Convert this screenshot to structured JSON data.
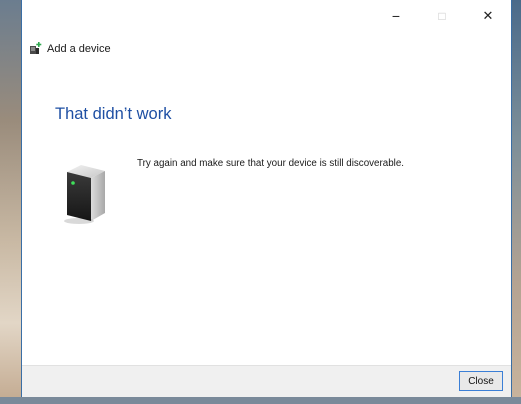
{
  "window": {
    "title": "Add a device",
    "controls": {
      "minimize": "−",
      "maximize": "□",
      "close": "✕"
    }
  },
  "content": {
    "heading": "That didn’t work",
    "message": "Try again and make sure that your device is still discoverable."
  },
  "footer": {
    "close_label": "Close"
  },
  "colors": {
    "heading": "#1e4fa3",
    "accent": "#3b7fd6",
    "footer_bg": "#f0f0f0"
  },
  "icons": {
    "header": "add-device-icon",
    "device": "computer-tower-icon"
  }
}
